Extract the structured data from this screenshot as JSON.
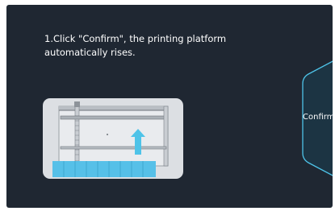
{
  "screen": {
    "instruction": "1.Click \"Confirm\", the printing platform automatically rises.",
    "confirm_label": "Confirm"
  },
  "colors": {
    "background": "#1f2732",
    "text": "#ffffff",
    "accent": "#4ec3e8",
    "button_border": "#4ec3e8",
    "illustration_panel": "#dcdfe3",
    "resin_vat": "#56c0e8"
  },
  "icons": {
    "illustration": "printer-platform-rising-illustration",
    "arrow": "up-arrow-icon"
  }
}
